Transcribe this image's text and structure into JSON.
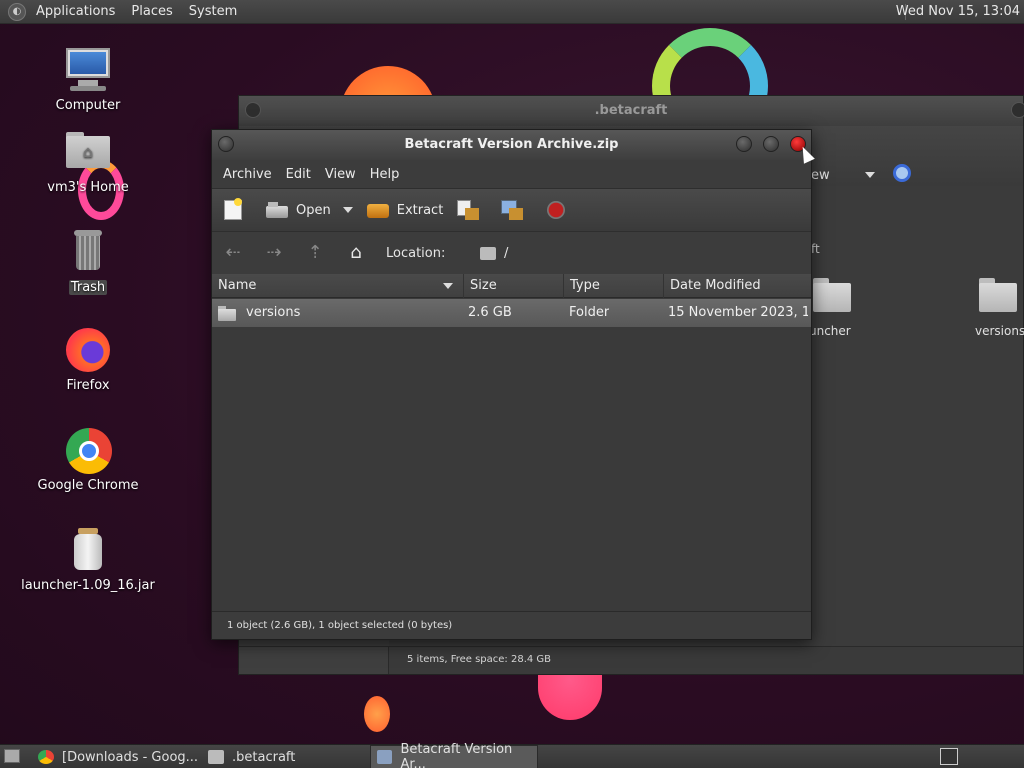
{
  "top_panel": {
    "menu": [
      "Applications",
      "Places",
      "System"
    ],
    "clock": "Wed Nov 15, 13:04"
  },
  "desktop_icons": [
    {
      "label": "Computer",
      "icon": "computer-icon"
    },
    {
      "label": "vm3's Home",
      "icon": "home-folder-icon"
    },
    {
      "label": "Trash",
      "icon": "trash-icon"
    },
    {
      "label": "Firefox",
      "icon": "firefox-icon"
    },
    {
      "label": "Google Chrome",
      "icon": "chrome-icon"
    },
    {
      "label": "launcher-1.09_16.jar",
      "icon": "jar-icon"
    }
  ],
  "back_window": {
    "title": ".betacraft",
    "view_label": "ew",
    "partial_path": "ft",
    "items": [
      "uncher",
      "versions"
    ],
    "status": "5 items, Free space: 28.4 GB"
  },
  "front_window": {
    "title": "Betacraft Version Archive.zip",
    "menu": [
      "Archive",
      "Edit",
      "View",
      "Help"
    ],
    "toolbar": {
      "open_label": "Open",
      "extract_label": "Extract"
    },
    "location_label": "Location:",
    "location_value": "/",
    "columns": [
      "Name",
      "Size",
      "Type",
      "Date Modified"
    ],
    "rows": [
      {
        "name": "versions",
        "size": "2.6 GB",
        "type": "Folder",
        "date": "15 November 2023, 1..."
      }
    ],
    "status": "1 object (2.6 GB), 1 object selected (0 bytes)"
  },
  "taskbar": {
    "tasks": [
      {
        "label": "[Downloads - Goog...",
        "icon": "chrome-icon"
      },
      {
        "label": ".betacraft",
        "icon": "folder-icon"
      },
      {
        "label": "Betacraft Version Ar...",
        "icon": "archive-icon"
      }
    ]
  },
  "colors": {
    "close_button": "#d01818",
    "wallpaper": "#2a0c22",
    "selected_row": "#606060"
  }
}
